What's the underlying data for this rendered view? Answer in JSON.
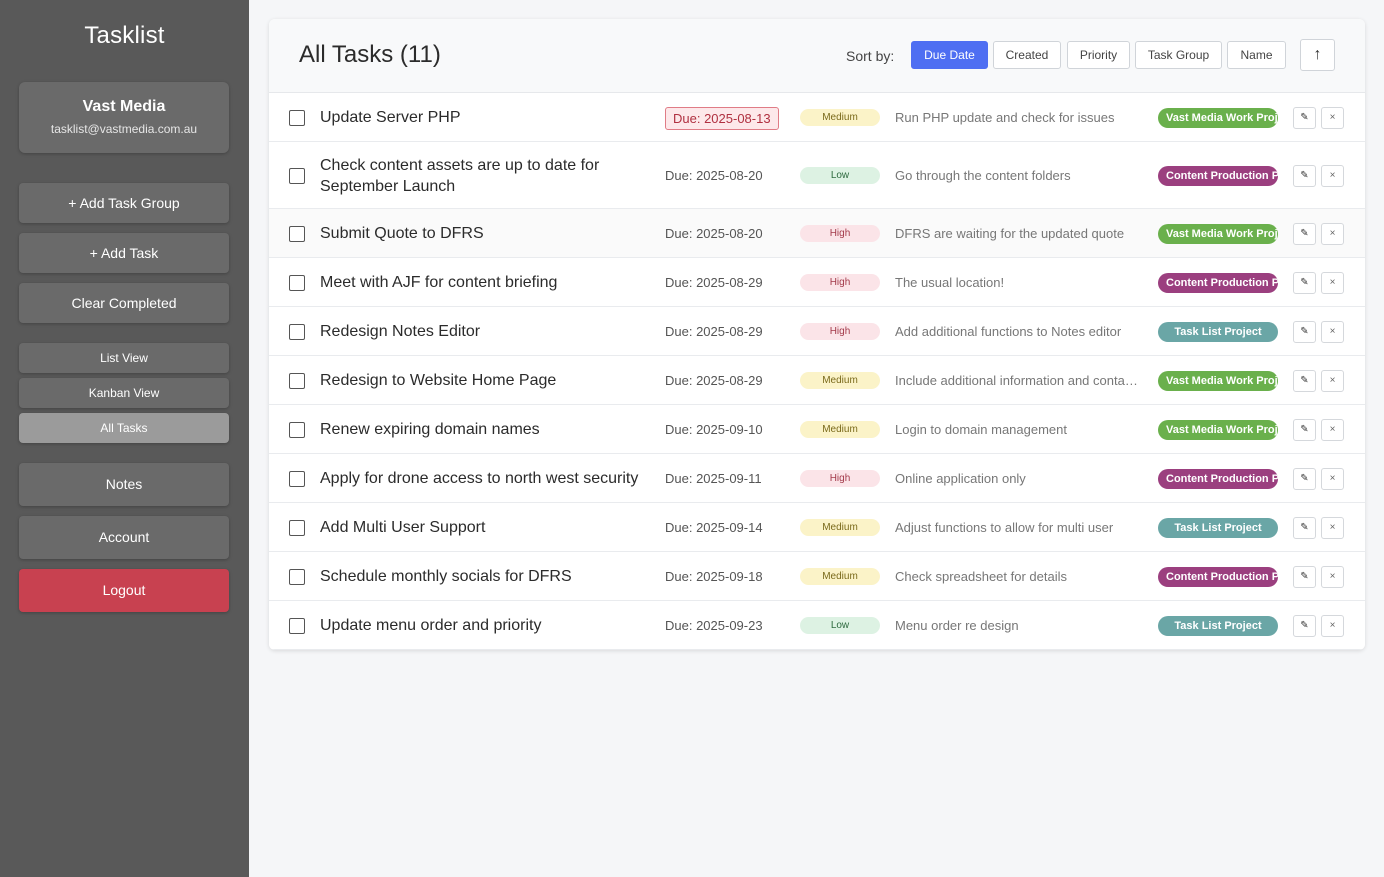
{
  "sidebar": {
    "app_title": "Tasklist",
    "user_name": "Vast Media",
    "user_email": "tasklist@vastmedia.com.au",
    "add_task_group": "+ Add Task Group",
    "add_task": "+ Add Task",
    "clear_completed": "Clear Completed",
    "list_view": "List View",
    "kanban_view": "Kanban View",
    "all_tasks": "All Tasks",
    "notes": "Notes",
    "account": "Account",
    "logout": "Logout"
  },
  "header": {
    "title": "All Tasks (11)",
    "sort_label": "Sort by:",
    "sort_options": [
      "Due Date",
      "Created",
      "Priority",
      "Task Group",
      "Name"
    ],
    "active_sort": "Due Date",
    "direction_icon": "↑"
  },
  "colors": {
    "vast_media": "#6ab04c",
    "content_production": "#9b3f7f",
    "task_list_project": "#6aa6a6"
  },
  "tasks": [
    {
      "name": "Update Server PHP",
      "due": "Due: 2025-08-13",
      "overdue": true,
      "priority": "Medium",
      "description": "Run PHP update and check for issues",
      "group": "Vast Media Work Projects"
    },
    {
      "name": "Check content assets are up to date for September Launch",
      "due": "Due: 2025-08-20",
      "overdue": false,
      "priority": "Low",
      "description": "Go through the content folders",
      "group": "Content Production Projects"
    },
    {
      "name": "Submit Quote to DFRS",
      "due": "Due: 2025-08-20",
      "overdue": false,
      "priority": "High",
      "description": "DFRS are waiting for the updated quote",
      "group": "Vast Media Work Projects"
    },
    {
      "name": "Meet with AJF for content briefing",
      "due": "Due: 2025-08-29",
      "overdue": false,
      "priority": "High",
      "description": "The usual location!",
      "group": "Content Production Projects"
    },
    {
      "name": "Redesign Notes Editor",
      "due": "Due: 2025-08-29",
      "overdue": false,
      "priority": "High",
      "description": "Add additional functions to Notes editor",
      "group": "Task List Project"
    },
    {
      "name": "Redesign to Website Home Page",
      "due": "Due: 2025-08-29",
      "overdue": false,
      "priority": "Medium",
      "description": "Include additional information and contact details",
      "group": "Vast Media Work Projects"
    },
    {
      "name": "Renew expiring domain names",
      "due": "Due: 2025-09-10",
      "overdue": false,
      "priority": "Medium",
      "description": "Login to domain management",
      "group": "Vast Media Work Projects"
    },
    {
      "name": "Apply for drone access to north west security",
      "due": "Due: 2025-09-11",
      "overdue": false,
      "priority": "High",
      "description": "Online application only",
      "group": "Content Production Projects"
    },
    {
      "name": "Add Multi User Support",
      "due": "Due: 2025-09-14",
      "overdue": false,
      "priority": "Medium",
      "description": "Adjust functions to allow for multi user",
      "group": "Task List Project"
    },
    {
      "name": "Schedule monthly socials for DFRS",
      "due": "Due: 2025-09-18",
      "overdue": false,
      "priority": "Medium",
      "description": "Check spreadsheet for details",
      "group": "Content Production Projects"
    },
    {
      "name": "Update menu order and priority",
      "due": "Due: 2025-09-23",
      "overdue": false,
      "priority": "Low",
      "description": "Menu order re design",
      "group": "Task List Project"
    }
  ],
  "icons": {
    "edit": "✎",
    "delete": "×"
  }
}
